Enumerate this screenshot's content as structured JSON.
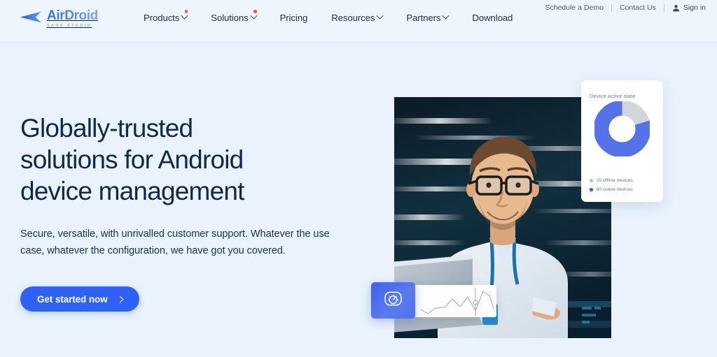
{
  "brand": {
    "name": "AirDroid",
    "tagline": "Sand Studio",
    "logo_icon": "airdroid-arrow-logo",
    "accent_blue": "#2f62f4",
    "headline_navy": "#11284b",
    "badge_orange": "#ef5b3c",
    "page_bg": "#eaf2fd",
    "header_bg": "#eff5fd"
  },
  "utility_nav": {
    "items": [
      {
        "label": "Schedule a Demo"
      },
      {
        "label": "Contact Us"
      }
    ],
    "sign_in": {
      "label": "Sign in",
      "icon": "user-icon"
    }
  },
  "main_nav": {
    "items": [
      {
        "label": "Products",
        "has_dropdown": true,
        "badge_dot": true
      },
      {
        "label": "Solutions",
        "has_dropdown": true,
        "badge_dot": true
      },
      {
        "label": "Pricing",
        "has_dropdown": false,
        "badge_dot": false
      },
      {
        "label": "Resources",
        "has_dropdown": true,
        "badge_dot": false
      },
      {
        "label": "Partners",
        "has_dropdown": true,
        "badge_dot": false
      },
      {
        "label": "Download",
        "has_dropdown": false,
        "badge_dot": false
      }
    ]
  },
  "hero": {
    "headline_line1": "Globally-trusted",
    "headline_line2": "solutions for Android",
    "headline_line3": "device management",
    "subhead": "Secure, versatile, with unrivalled customer support. Whatever the use case, whatever the configuration, we have got you covered.",
    "cta_label": "Get started now",
    "cta_icon": "chevron-right-icon",
    "photo_alt": "IT professional holding a laptop in a data center"
  },
  "chart_data": {
    "type": "pie",
    "title": "Device active state",
    "categories": [
      "80 online devices",
      "20 offline devices"
    ],
    "values": [
      80,
      20
    ],
    "colors": [
      "#5572e8",
      "#d2d5da"
    ],
    "donut": true,
    "legend_position": "bottom-left",
    "legend": [
      {
        "label": "20 offline devices",
        "color": "#b9bec6",
        "value": 20
      },
      {
        "label": "80 online devices",
        "color": "#2f62f4",
        "value": 80
      }
    ]
  },
  "widgets": {
    "gauge": {
      "icon": "speedometer-icon",
      "label": "performance-gauge"
    },
    "sparkline": {
      "type": "line",
      "label": "activity-sparkline",
      "values": [
        22,
        34,
        28,
        30,
        14,
        26,
        36,
        6,
        40,
        34,
        18
      ],
      "marker_index": 7,
      "line_color": "#b4b7bd"
    }
  }
}
